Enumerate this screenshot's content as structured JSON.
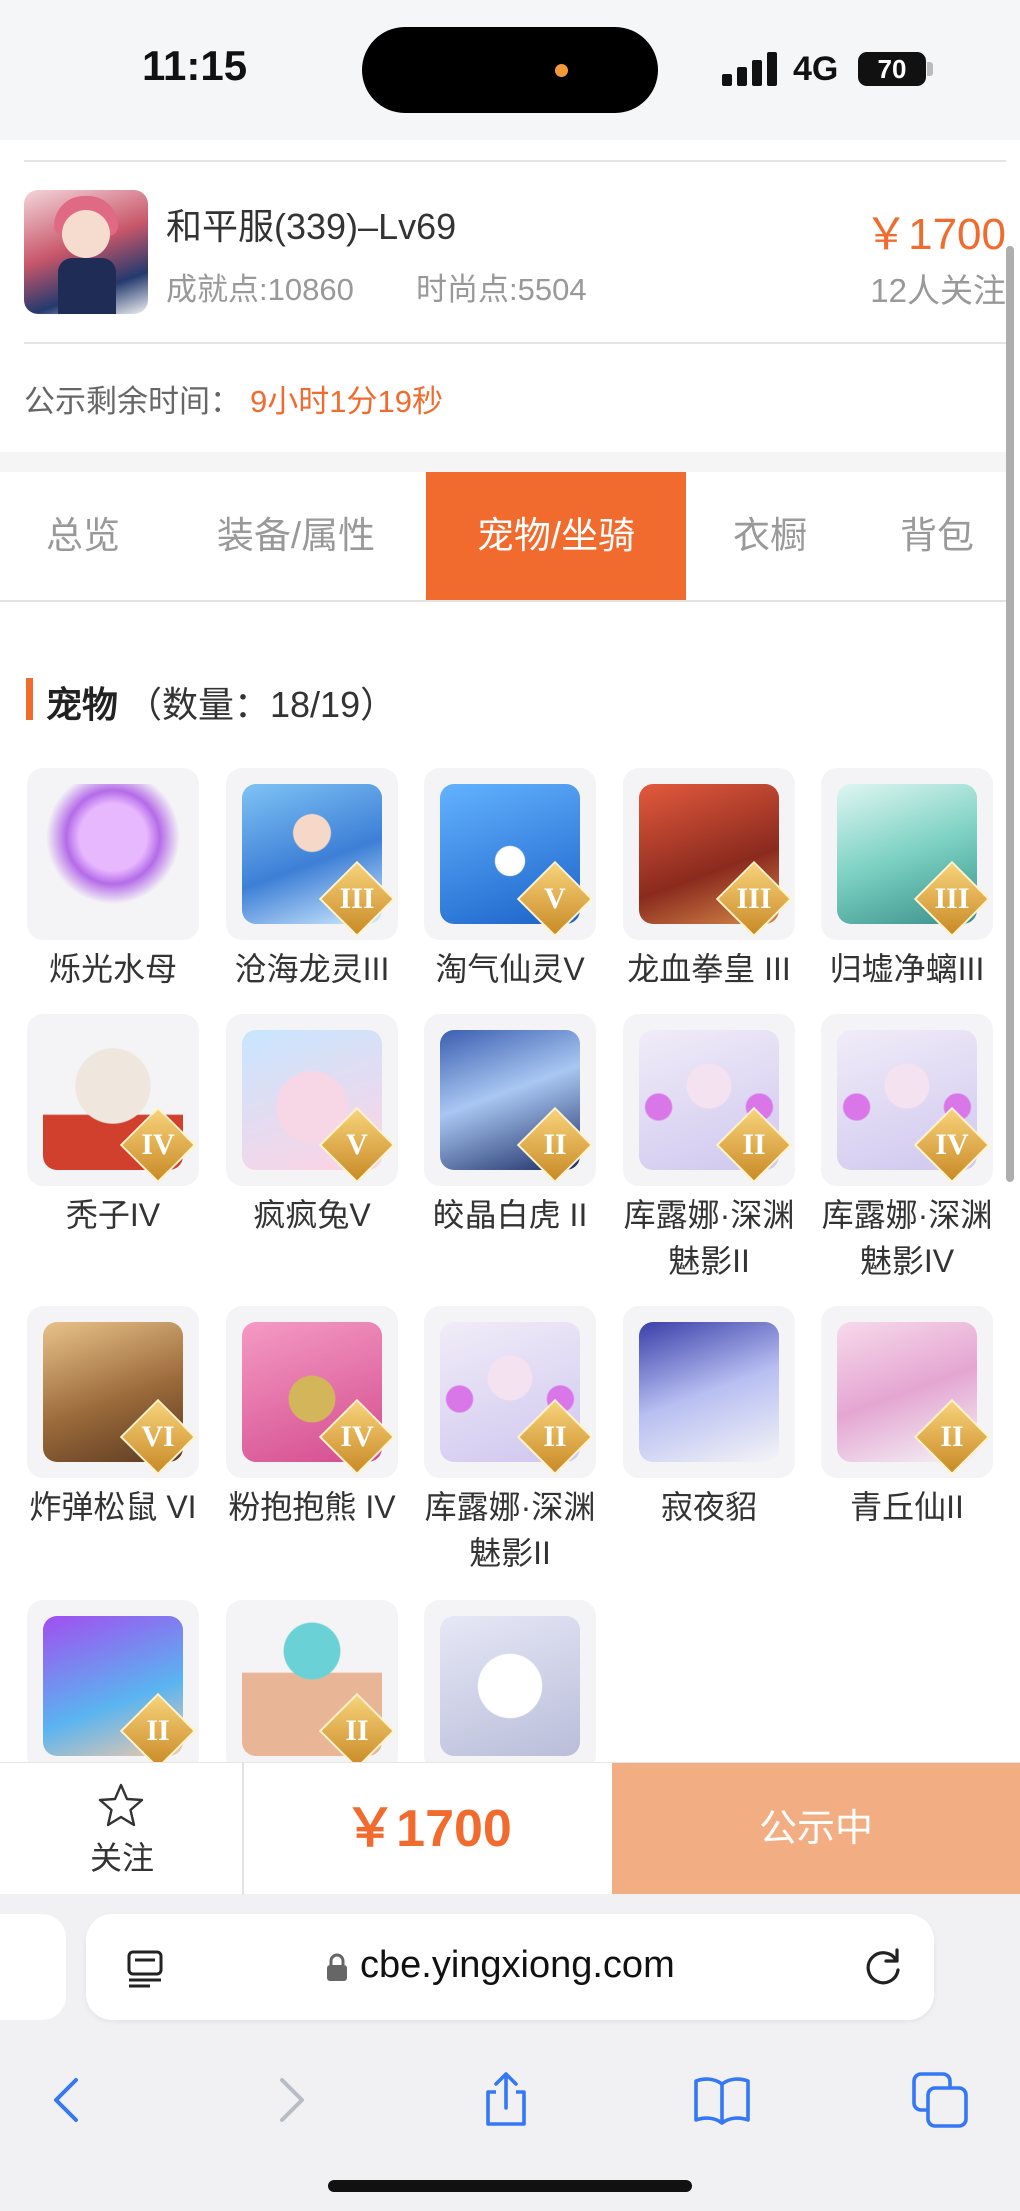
{
  "status_bar": {
    "time": "11:15",
    "network": "4G",
    "battery": "70"
  },
  "product": {
    "server": "和平服(339)–Lv69",
    "achievement": "成就点:10860",
    "fashion": "时尚点:5504",
    "price": "￥1700",
    "watchers": "12人关注",
    "countdown_label": "公示剩余时间：",
    "countdown_value": "9小时1分19秒"
  },
  "tabs": [
    {
      "label": "总览"
    },
    {
      "label": "装备/属性"
    },
    {
      "label": "宠物/坐骑",
      "active": true
    },
    {
      "label": "衣橱"
    },
    {
      "label": "背包"
    }
  ],
  "pets_section": {
    "title": "宠物",
    "count": "（数量：18/19）"
  },
  "pets": [
    {
      "name": "烁光水母",
      "grade": "",
      "art": "jellyfish"
    },
    {
      "name": "沧海龙灵III",
      "grade": "III",
      "art": "dragon-spirit"
    },
    {
      "name": "淘气仙灵V",
      "grade": "V",
      "art": "blue-pup"
    },
    {
      "name": "龙血拳皇 III",
      "grade": "III",
      "art": "red-demon"
    },
    {
      "name": "归墟净螭III",
      "grade": "III",
      "art": "jade-dragon"
    },
    {
      "name": "秃子IV",
      "grade": "IV",
      "art": "bald-kid"
    },
    {
      "name": "疯疯兔V",
      "grade": "V",
      "art": "crazy-rabbit"
    },
    {
      "name": "皎晶白虎 II",
      "grade": "II",
      "art": "white-tiger"
    },
    {
      "name": "库露娜·深渊魅影II",
      "grade": "II",
      "art": "kuluna"
    },
    {
      "name": "库露娜·深渊魅影IV",
      "grade": "IV",
      "art": "kuluna"
    },
    {
      "name": "炸弹松鼠 VI",
      "grade": "VI",
      "art": "bomb-squirrel"
    },
    {
      "name": "粉抱抱熊 IV",
      "grade": "IV",
      "art": "pink-bear"
    },
    {
      "name": "库露娜·深渊魅影II",
      "grade": "II",
      "art": "kuluna"
    },
    {
      "name": "寂夜貂",
      "grade": "",
      "art": "night-marten"
    },
    {
      "name": "青丘仙II",
      "grade": "II",
      "art": "fox-fairy"
    },
    {
      "name": "",
      "grade": "II",
      "art": "purple-elf"
    },
    {
      "name": "",
      "grade": "II",
      "art": "muscle-chick"
    },
    {
      "name": "",
      "grade": "",
      "art": "astro-cow"
    }
  ],
  "action_bar": {
    "follow_label": "关注",
    "price": "￥1700",
    "status_button": "公示中"
  },
  "browser": {
    "url": "cbe.yingxiong.com"
  },
  "colors": {
    "accent": "#f26b2e",
    "accent_light": "#f2ae82"
  }
}
